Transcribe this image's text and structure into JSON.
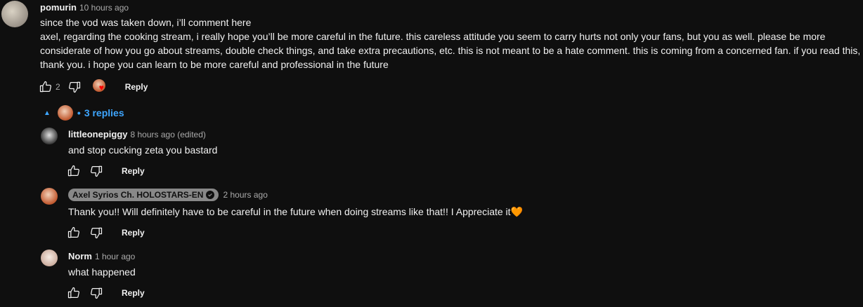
{
  "main_comment": {
    "author": "pomurin",
    "time": "10 hours ago",
    "lines": [
      "since the vod was taken down, i’ll comment here",
      "axel, regarding the cooking stream, i really hope you’ll be more careful in the future. this careless attitude you seem to carry hurts not only your fans, but you as well. please be more",
      "considerate of how you go about streams, double check things, and take extra precautions, etc. this is not meant to be a hate comment. this is coming from a concerned fan. if you read this,",
      "thank you. i hope you can learn to be more careful and professional in the future"
    ],
    "like_count": "2",
    "reply_label": "Reply"
  },
  "replies_toggle": {
    "label": "3 replies"
  },
  "replies": [
    {
      "author": "littleonepiggy",
      "time": "8 hours ago (edited)",
      "text": "and stop cucking zeta you bastard",
      "reply_label": "Reply"
    },
    {
      "author": "Axel Syrios Ch. HOLOSTARS-EN",
      "time": "2 hours ago",
      "text": "Thank you!! Will definitely have to be careful in the future when doing streams like that!! I Appreciate it",
      "heart": "🧡",
      "reply_label": "Reply"
    },
    {
      "author": "Norm",
      "time": "1 hour ago",
      "text": "what happened",
      "reply_label": "Reply"
    }
  ],
  "colors": {
    "background": "#0f0f0f",
    "text": "#f1f1f1",
    "secondary": "#aaaaaa",
    "link_blue": "#3ea6ff",
    "owner_pill": "#888888",
    "heart_red": "#ff0000"
  }
}
